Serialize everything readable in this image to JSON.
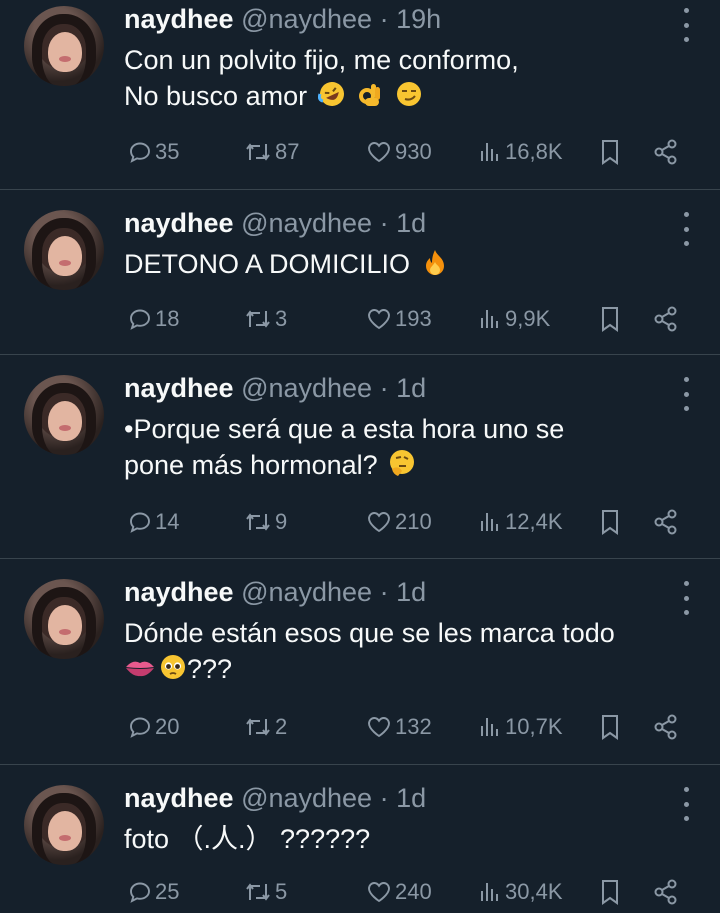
{
  "tweets": [
    {
      "name": "naydhee",
      "handle": "@naydhee",
      "dot": "·",
      "time": "19h",
      "text_lines": [
        "Con un polvito fijo, me conformo,",
        "No busco amor"
      ],
      "emojis": [
        "rofl-face",
        "ok-hand",
        "smirk-face"
      ],
      "replies": "35",
      "retweets": "87",
      "likes": "930",
      "views": "16,8K"
    },
    {
      "name": "naydhee",
      "handle": "@naydhee",
      "dot": "·",
      "time": "1d",
      "text_lines": [
        "DETONO A DOMICILIO"
      ],
      "emojis": [
        "fire"
      ],
      "replies": "18",
      "retweets": "3",
      "likes": "193",
      "views": "9,9K"
    },
    {
      "name": "naydhee",
      "handle": "@naydhee",
      "dot": "·",
      "time": "1d",
      "text_lines": [
        "•Porque será que a esta hora uno se",
        "pone más hormonal?"
      ],
      "emojis": [
        "thinking-face"
      ],
      "replies": "14",
      "retweets": "9",
      "likes": "210",
      "views": "12,4K"
    },
    {
      "name": "naydhee",
      "handle": "@naydhee",
      "dot": "·",
      "time": "1d",
      "text_lines": [
        "Dónde están esos que se les marca todo",
        ""
      ],
      "line2_suffix": "???",
      "emojis": [
        "lips",
        "pleading-face"
      ],
      "replies": "20",
      "retweets": "2",
      "likes": "132",
      "views": "10,7K"
    },
    {
      "name": "naydhee",
      "handle": "@naydhee",
      "dot": "·",
      "time": "1d",
      "text_lines": [
        "foto （.人.） ??????"
      ],
      "emojis": [],
      "replies": "25",
      "retweets": "5",
      "likes": "240",
      "views": "30,4K"
    }
  ],
  "icons": {
    "reply": "reply-icon",
    "retweet": "retweet-icon",
    "like": "like-icon",
    "views": "views-icon",
    "bookmark": "bookmark-icon",
    "share": "share-icon",
    "more": "more-icon"
  },
  "colors": {
    "background": "#15202b",
    "text": "#f7f9f9",
    "secondary": "#8b98a5",
    "divider": "#38444d"
  }
}
